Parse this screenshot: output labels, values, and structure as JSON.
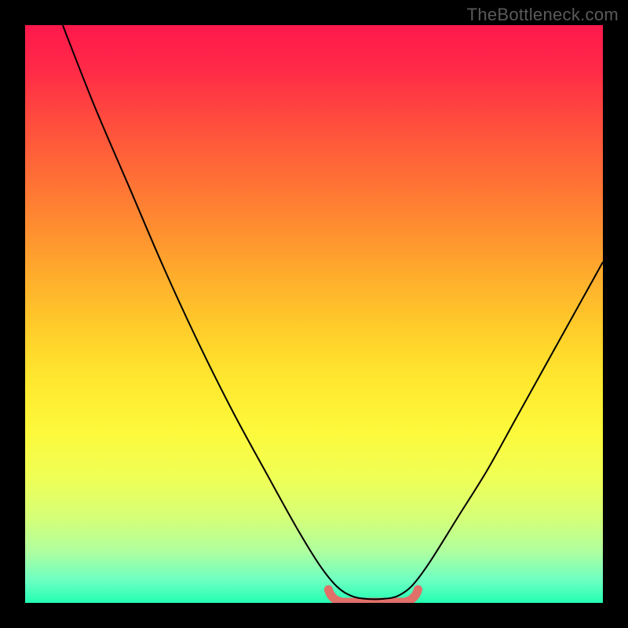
{
  "watermark": "TheBottleneck.com",
  "chart_data": {
    "type": "line",
    "title": "",
    "xlabel": "",
    "ylabel": "",
    "xlim": [
      0,
      100
    ],
    "ylim": [
      0,
      100
    ],
    "grid": false,
    "legend": false,
    "curve_points": [
      {
        "x": 6.5,
        "y": 100
      },
      {
        "x": 12,
        "y": 86
      },
      {
        "x": 18,
        "y": 72
      },
      {
        "x": 24,
        "y": 58
      },
      {
        "x": 30,
        "y": 45
      },
      {
        "x": 36,
        "y": 33
      },
      {
        "x": 42,
        "y": 22
      },
      {
        "x": 47,
        "y": 13
      },
      {
        "x": 51,
        "y": 6.5
      },
      {
        "x": 54,
        "y": 2.8
      },
      {
        "x": 56.5,
        "y": 1.2
      },
      {
        "x": 59,
        "y": 0.7
      },
      {
        "x": 62,
        "y": 0.7
      },
      {
        "x": 64.5,
        "y": 1.2
      },
      {
        "x": 67,
        "y": 3.0
      },
      {
        "x": 70,
        "y": 7
      },
      {
        "x": 75,
        "y": 15
      },
      {
        "x": 80,
        "y": 23
      },
      {
        "x": 85,
        "y": 32
      },
      {
        "x": 90,
        "y": 41
      },
      {
        "x": 95,
        "y": 50
      },
      {
        "x": 100,
        "y": 59
      }
    ],
    "accent_segment": {
      "x_start": 52.5,
      "x_end": 68,
      "y": 1.5
    }
  }
}
